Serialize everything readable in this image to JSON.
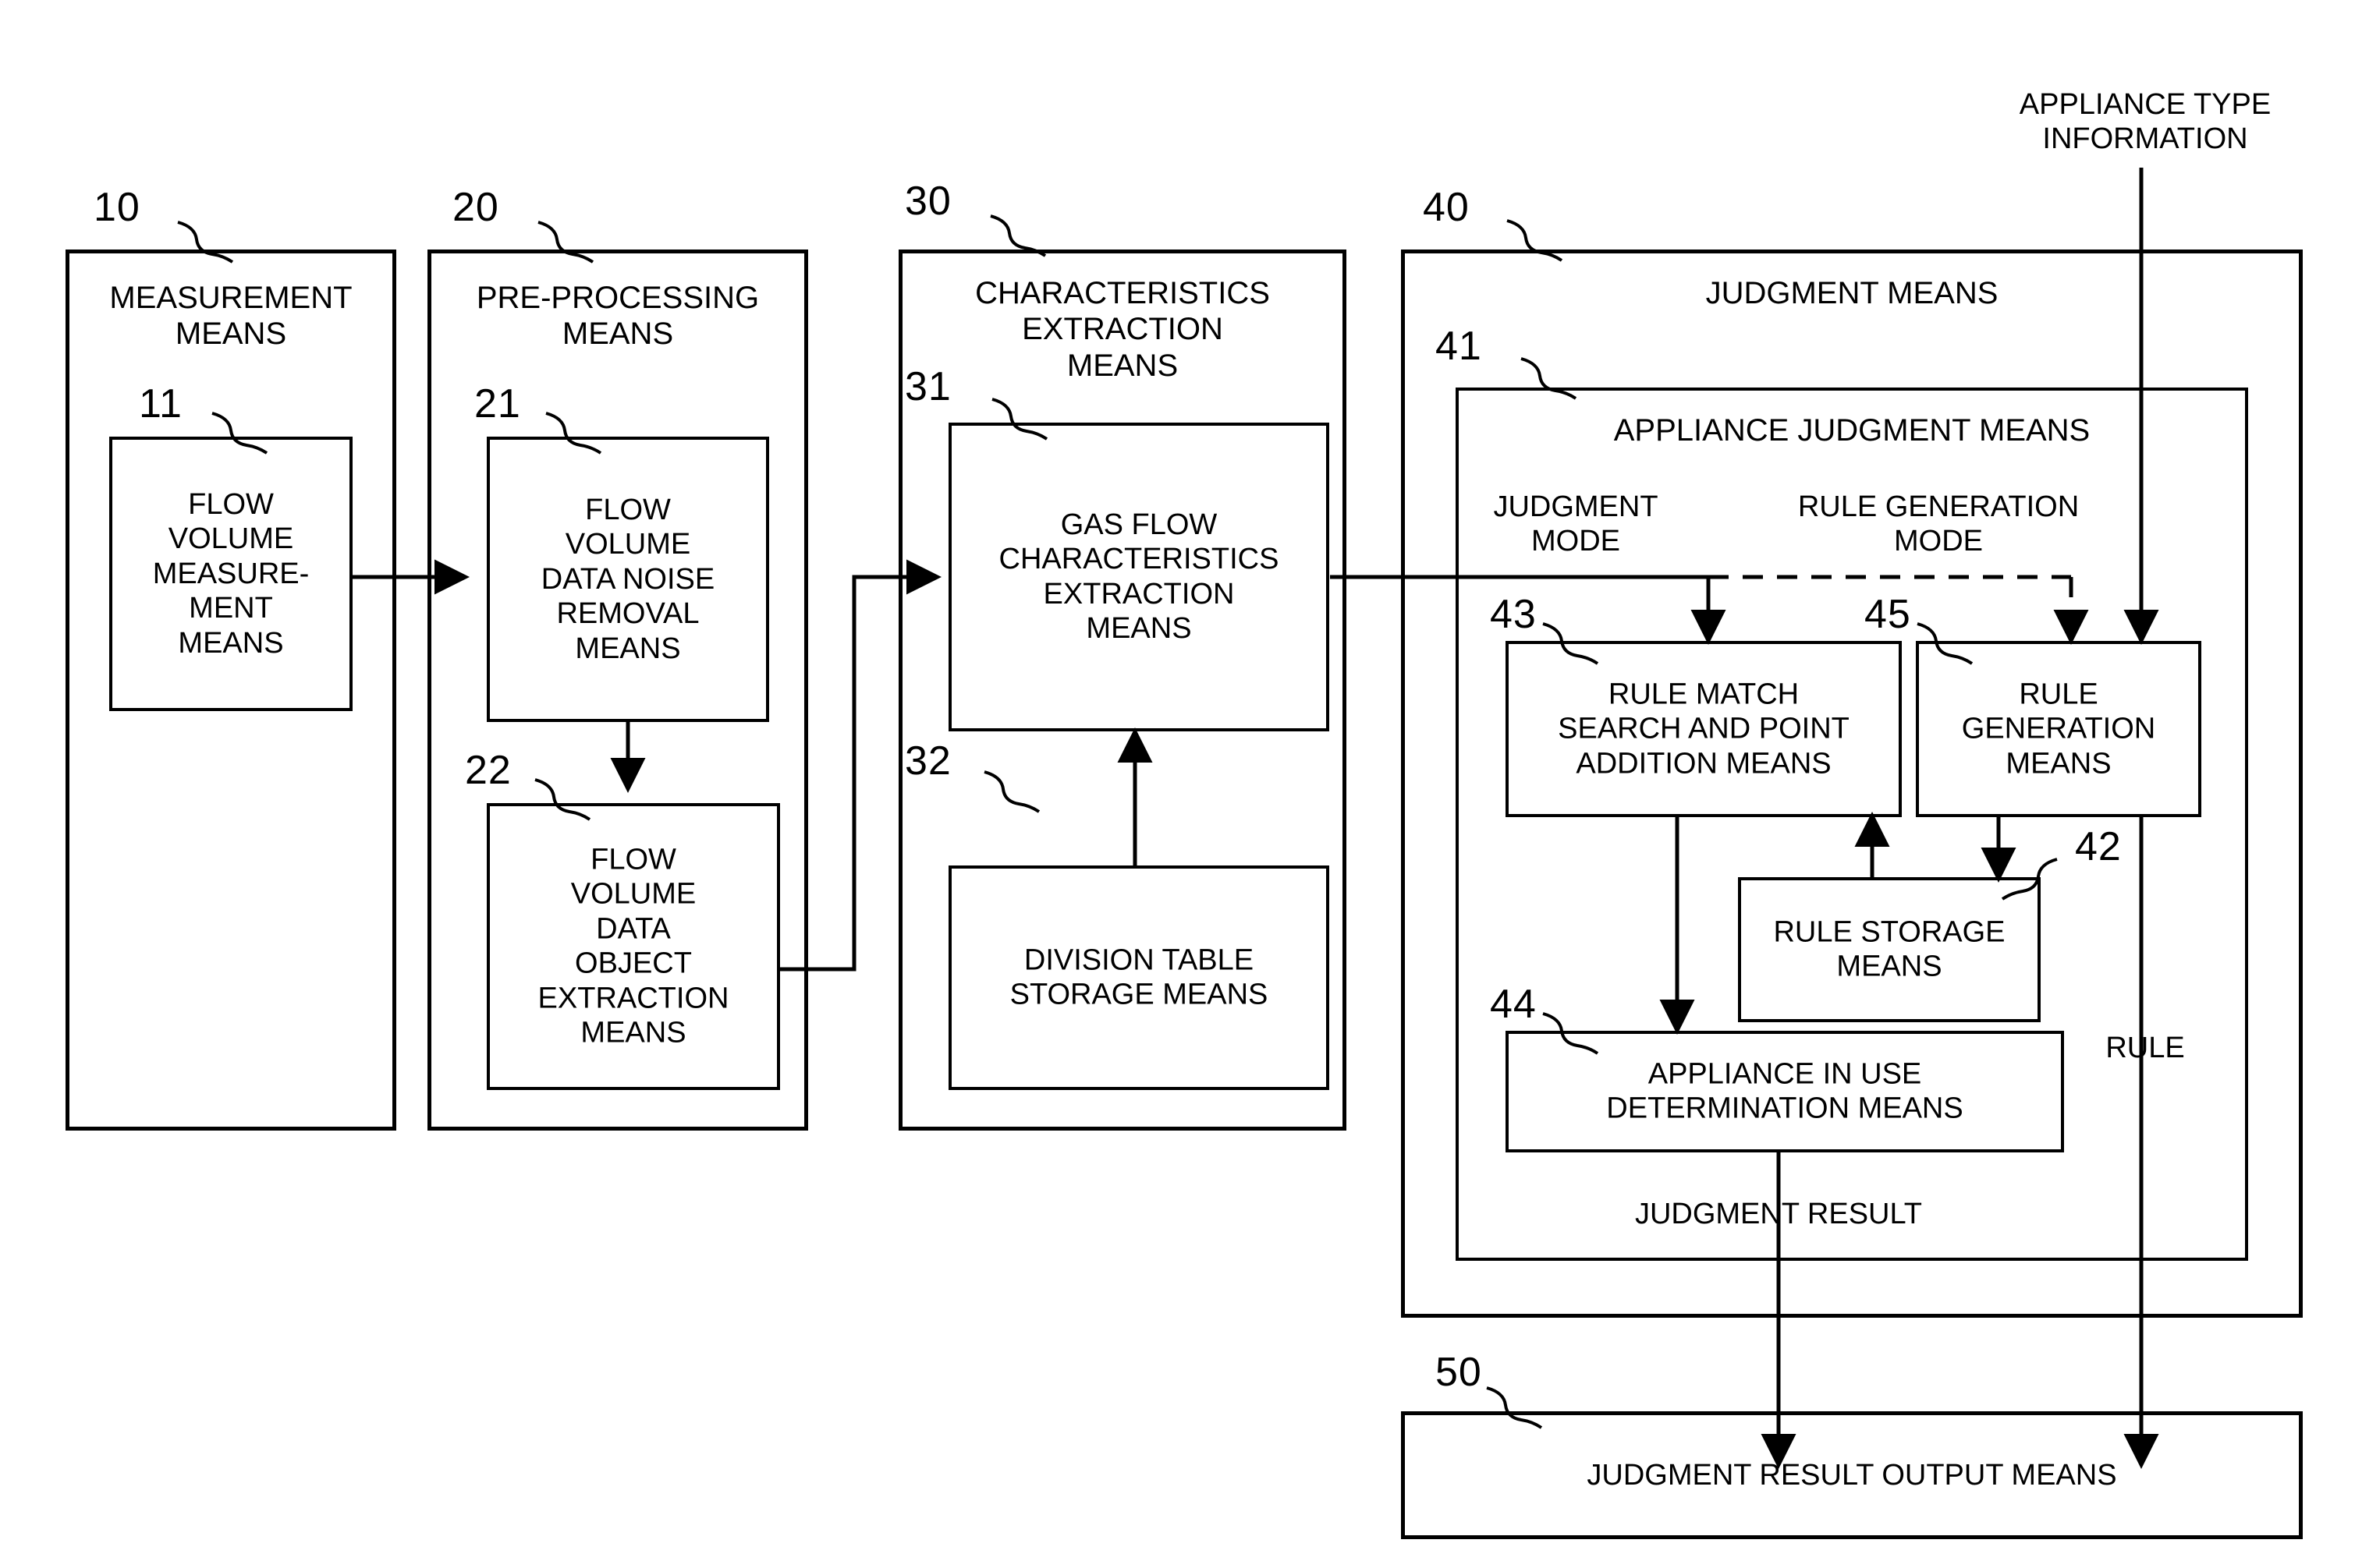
{
  "figure": {
    "title": "Gas appliance judgment system block diagram",
    "external_inputs": {
      "appliance_type_information": "APPLIANCE TYPE\nINFORMATION"
    },
    "signal_labels": {
      "judgment_result": "JUDGMENT RESULT",
      "rule": "RULE"
    },
    "mode_labels": {
      "judgment_mode": "JUDGMENT\nMODE",
      "rule_generation_mode": "RULE GENERATION\nMODE"
    },
    "blocks": [
      {
        "ref": "10",
        "name": "measurement-means",
        "label": "MEASUREMENT\nMEANS",
        "children": [
          {
            "ref": "11",
            "name": "flow-volume-measurement-means",
            "label": "FLOW\nVOLUME\nMEASURE-\nMENT\nMEANS"
          }
        ]
      },
      {
        "ref": "20",
        "name": "pre-processing-means",
        "label": "PRE-PROCESSING\nMEANS",
        "children": [
          {
            "ref": "21",
            "name": "flow-volume-data-noise-removal-means",
            "label": "FLOW\nVOLUME\nDATA NOISE\nREMOVAL\nMEANS"
          },
          {
            "ref": "22",
            "name": "flow-volume-data-object-extraction-means",
            "label": "FLOW\nVOLUME\nDATA\nOBJECT\nEXTRACTION\nMEANS"
          }
        ]
      },
      {
        "ref": "30",
        "name": "characteristics-extraction-means",
        "label": "CHARACTERISTICS\nEXTRACTION\nMEANS",
        "children": [
          {
            "ref": "31",
            "name": "gas-flow-characteristics-extraction-means",
            "label": "GAS FLOW\nCHARACTERISTICS\nEXTRACTION\nMEANS"
          },
          {
            "ref": "32",
            "name": "division-table-storage-means",
            "label": "DIVISION TABLE\nSTORAGE MEANS"
          }
        ]
      },
      {
        "ref": "40",
        "name": "judgment-means",
        "label": "JUDGMENT MEANS",
        "children": [
          {
            "ref": "41",
            "name": "appliance-judgment-means",
            "label": "APPLIANCE JUDGMENT MEANS",
            "children": [
              {
                "ref": "43",
                "name": "rule-match-search-and-point-addition-means",
                "label": "RULE MATCH\nSEARCH AND POINT\nADDITION MEANS"
              },
              {
                "ref": "45",
                "name": "rule-generation-means",
                "label": "RULE\nGENERATION\nMEANS"
              },
              {
                "ref": "42",
                "name": "rule-storage-means",
                "label": "RULE STORAGE\nMEANS"
              },
              {
                "ref": "44",
                "name": "appliance-in-use-determination-means",
                "label": "APPLIANCE IN USE\nDETERMINATION MEANS"
              }
            ]
          }
        ]
      },
      {
        "ref": "50",
        "name": "judgment-result-output-means",
        "label": "JUDGMENT RESULT OUTPUT MEANS"
      }
    ]
  }
}
